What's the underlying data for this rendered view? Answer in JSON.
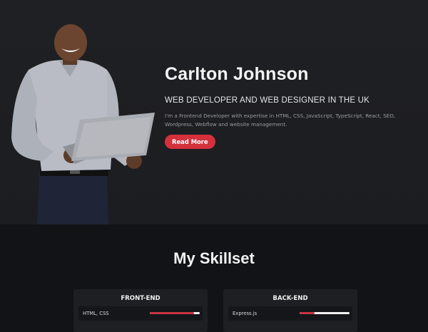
{
  "hero": {
    "name": "Carlton Johnson",
    "subtitle": "WEB DEVELOPER AND WEB DESIGNER IN THE UK",
    "description": "I'm a Frontend Developer with expertise in HTML, CSS, JavaScript, TypeScript, React, SEO, Wordpress, Webflow and website management.",
    "button_label": "Read More",
    "accent": "#d4313d"
  },
  "skills": {
    "title": "My Skillset",
    "cards": [
      {
        "heading": "FRONT-END",
        "items": [
          {
            "label": "HTML, CSS",
            "level": 0.88
          }
        ]
      },
      {
        "heading": "BACK-END",
        "items": [
          {
            "label": "Express.js",
            "level": 0.3
          }
        ]
      }
    ]
  }
}
